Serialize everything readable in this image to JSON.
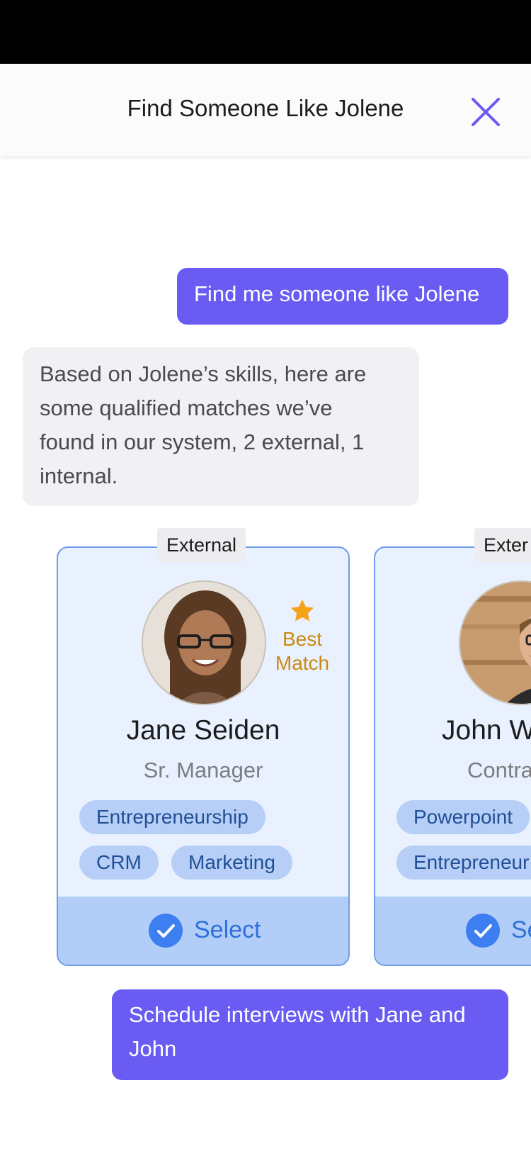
{
  "header": {
    "title": "Find Someone Like Jolene",
    "close_icon": "close-icon"
  },
  "conversation": {
    "user_message_1": "Find me someone like Jolene",
    "bot_message_lines": [
      "Based on Jolene’s skills, here are",
      "some qualified matches we’ve",
      "found in our system, 2 external, 1",
      "internal."
    ],
    "user_message_2_lines": [
      "Schedule interviews with Jane and",
      "John"
    ]
  },
  "candidates": [
    {
      "tag": "External",
      "name": "Jane Seiden",
      "role": "Sr. Manager",
      "badge_line1": "Best",
      "badge_line2": "Match",
      "skills": [
        "Entrepreneurship",
        "CRM",
        "Marketing"
      ],
      "select_label": "Select"
    },
    {
      "tag": "Exter",
      "name": "John W",
      "role": "Contra",
      "skills": [
        "Powerpoint",
        "Entrepreneur"
      ],
      "select_label": "Se"
    }
  ],
  "colors": {
    "accent": "#6a5cf2",
    "card_bg": "#e9f1fe",
    "chip_bg": "#b7cff7",
    "select_bar": "#b2cef8",
    "badge": "#c98a0f"
  }
}
